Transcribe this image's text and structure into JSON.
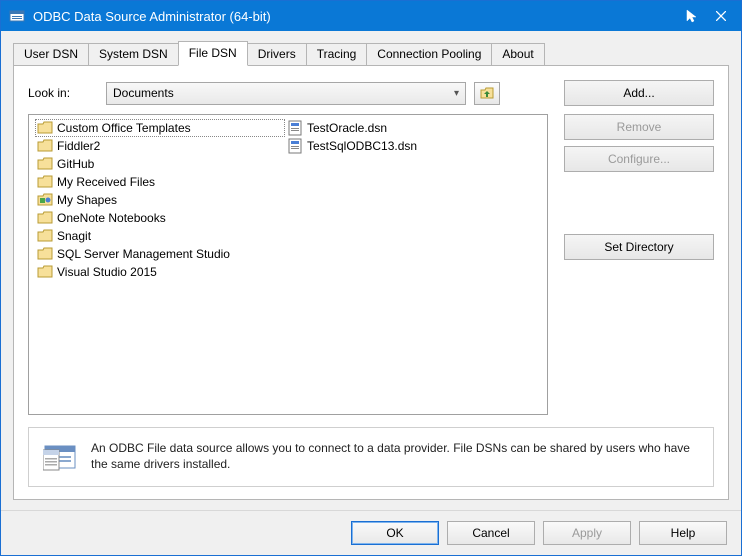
{
  "title": "ODBC Data Source Administrator (64-bit)",
  "tabs": [
    "User DSN",
    "System DSN",
    "File DSN",
    "Drivers",
    "Tracing",
    "Connection Pooling",
    "About"
  ],
  "active_tab_index": 2,
  "lookin_label": "Look in:",
  "lookin_value": "Documents",
  "folders": [
    "Custom Office Templates",
    "Fiddler2",
    "GitHub",
    "My Received Files",
    "My Shapes",
    "OneNote Notebooks",
    "Snagit",
    "SQL Server Management Studio",
    "Visual Studio 2015"
  ],
  "files": [
    "TestOracle.dsn",
    "TestSqlODBC13.dsn"
  ],
  "selected_item": "Custom Office Templates",
  "side_buttons": {
    "add": "Add...",
    "remove": "Remove",
    "configure": "Configure...",
    "set_directory": "Set Directory"
  },
  "description": "An ODBC File data source allows you to connect to a data provider.  File DSNs can be shared by users who have the same drivers installed.",
  "bottom": {
    "ok": "OK",
    "cancel": "Cancel",
    "apply": "Apply",
    "help": "Help"
  }
}
